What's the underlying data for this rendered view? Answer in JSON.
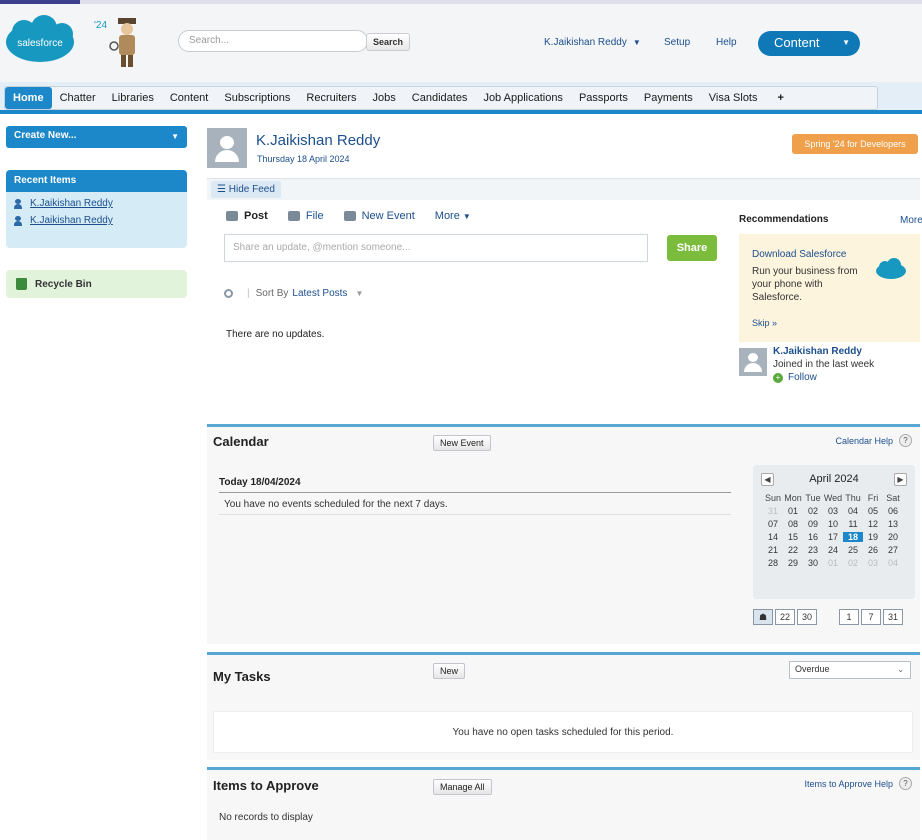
{
  "header": {
    "logo_text": "salesforce",
    "release_badge": "'24",
    "search": {
      "placeholder": "Search...",
      "button_label": "Search"
    },
    "user_menu": "K.Jaikishan Reddy",
    "setup": "Setup",
    "help": "Help",
    "app_menu": "Content"
  },
  "tabs": [
    {
      "label": "Home",
      "active": true
    },
    {
      "label": "Chatter"
    },
    {
      "label": "Libraries"
    },
    {
      "label": "Content"
    },
    {
      "label": "Subscriptions"
    },
    {
      "label": "Recruiters"
    },
    {
      "label": "Jobs"
    },
    {
      "label": "Candidates"
    },
    {
      "label": "Job Applications"
    },
    {
      "label": "Passports"
    },
    {
      "label": "Payments"
    },
    {
      "label": "Visa Slots"
    },
    {
      "label": "+"
    }
  ],
  "sidebar": {
    "create_new": "Create New...",
    "recent_items_title": "Recent Items",
    "recent_items": [
      "K.Jaikishan Reddy",
      "K.Jaikishan Reddy"
    ],
    "recycle_bin": "Recycle Bin"
  },
  "profile": {
    "name": "K.Jaikishan Reddy",
    "date": "Thursday 18 April 2024",
    "release_label": "Spring '24 for Developers",
    "hide_feed": "Hide Feed"
  },
  "publisher": {
    "tabs": [
      "Post",
      "File",
      "New Event",
      "More"
    ],
    "input_placeholder": "Share an update, @mention someone...",
    "share_label": "Share",
    "sort_label": "Sort By",
    "sort_value": "Latest Posts",
    "empty_text": "There are no updates."
  },
  "recommendations": {
    "title": "Recommendations",
    "more": "More",
    "card_link": "Download Salesforce",
    "card_text": "Run your business from your phone with Salesforce.",
    "skip": "Skip »",
    "person_name": "K.Jaikishan Reddy",
    "person_sub": "Joined in the last week",
    "follow": "Follow"
  },
  "calendar": {
    "title": "Calendar",
    "new_event": "New Event",
    "help": "Calendar Help",
    "today_label": "Today 18/04/2024",
    "empty_text": "You have no events scheduled for the next 7 days.",
    "month": "April 2024",
    "day_names": [
      "Sun",
      "Mon",
      "Tue",
      "Wed",
      "Thu",
      "Fri",
      "Sat"
    ],
    "days": [
      "31",
      "01",
      "02",
      "03",
      "04",
      "05",
      "06",
      "07",
      "08",
      "09",
      "10",
      "11",
      "12",
      "13",
      "14",
      "15",
      "16",
      "17",
      "18",
      "19",
      "20",
      "21",
      "22",
      "23",
      "24",
      "25",
      "26",
      "27",
      "28",
      "29",
      "30",
      "01",
      "02",
      "03",
      "04"
    ],
    "selected_day": "18",
    "view_buttons_left": [
      "☗",
      "22",
      "30"
    ],
    "view_buttons_right": [
      "1",
      "7",
      "31"
    ]
  },
  "tasks": {
    "title": "My Tasks",
    "new": "New",
    "filter": "Overdue",
    "empty_text": "You have no open tasks scheduled for this period."
  },
  "approvals": {
    "title": "Items to Approve",
    "manage_all": "Manage All",
    "help": "Items to Approve Help",
    "empty_text": "No records to display"
  },
  "colors": {
    "brand_blue": "#1c87c9",
    "share_green": "#7cbc3c",
    "badge_orange": "#f0a04b"
  }
}
